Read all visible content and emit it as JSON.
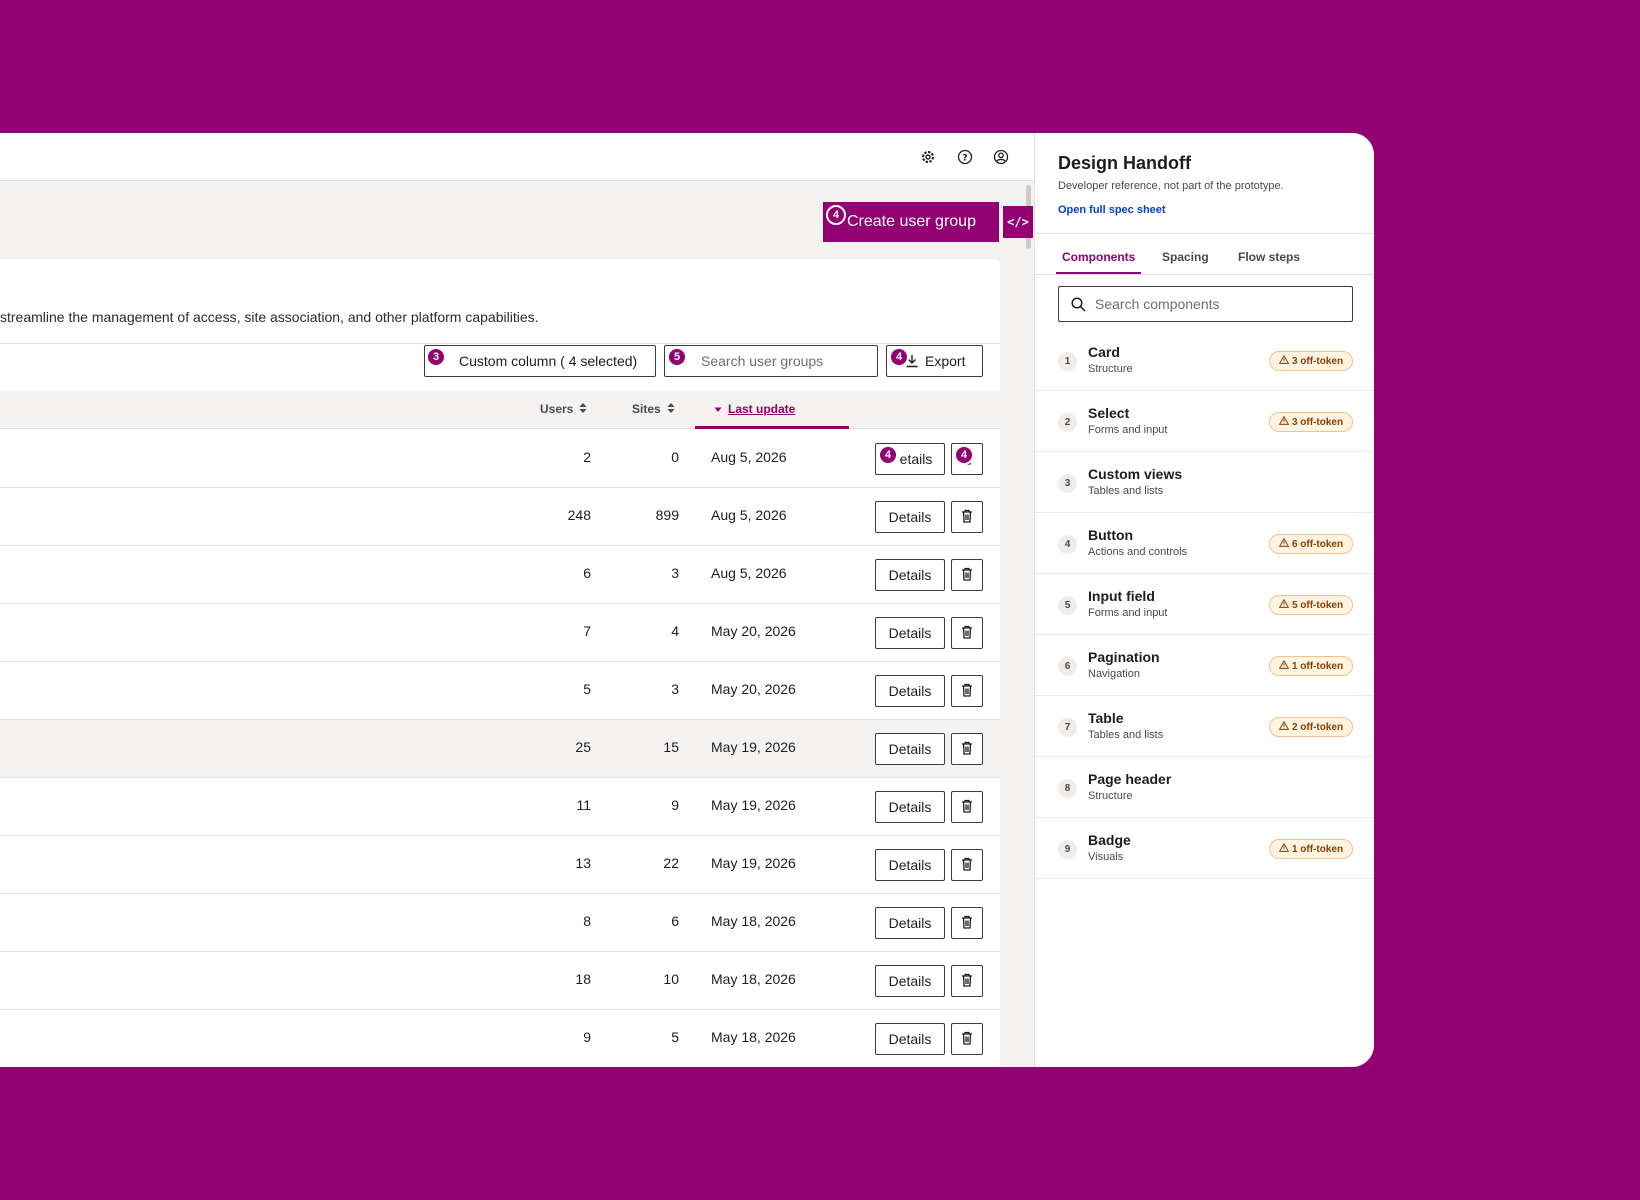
{
  "colors": {
    "brand": "#920071",
    "background": "#920071",
    "link": "#0043ce",
    "badge_bg": "#fff3e2",
    "badge_text": "#8a3f00"
  },
  "topbar": {
    "icons": [
      "gear-icon",
      "help-icon",
      "user-avatar-icon"
    ]
  },
  "page": {
    "create_button_label": "Create user group",
    "create_marker": "4",
    "code_button_label": "</>",
    "description": "streamline the management of access, site association, and other platform capabilities."
  },
  "toolbar": {
    "custom_column_label": "Custom column ( 4  selected)",
    "custom_column_marker": "3",
    "search_placeholder": "Search user groups",
    "search_marker": "5",
    "export_label": "Export",
    "export_marker": "4"
  },
  "table": {
    "columns": {
      "users": "Users",
      "sites": "Sites",
      "last_update": "Last update"
    },
    "details_label": "Details",
    "first_row_markers": [
      "4",
      "4"
    ],
    "rows": [
      {
        "users": "2",
        "sites": "0",
        "date": "Aug 5, 2026",
        "details": "etails"
      },
      {
        "users": "248",
        "sites": "899",
        "date": "Aug 5, 2026",
        "details": "Details"
      },
      {
        "users": "6",
        "sites": "3",
        "date": "Aug 5, 2026",
        "details": "Details"
      },
      {
        "users": "7",
        "sites": "4",
        "date": "May 20, 2026",
        "details": "Details"
      },
      {
        "users": "5",
        "sites": "3",
        "date": "May 20, 2026",
        "details": "Details"
      },
      {
        "users": "25",
        "sites": "15",
        "date": "May 19, 2026",
        "details": "Details"
      },
      {
        "users": "11",
        "sites": "9",
        "date": "May 19, 2026",
        "details": "Details"
      },
      {
        "users": "13",
        "sites": "22",
        "date": "May 19, 2026",
        "details": "Details"
      },
      {
        "users": "8",
        "sites": "6",
        "date": "May 18, 2026",
        "details": "Details"
      },
      {
        "users": "18",
        "sites": "10",
        "date": "May 18, 2026",
        "details": "Details"
      },
      {
        "users": "9",
        "sites": "5",
        "date": "May 18, 2026",
        "details": "Details"
      }
    ]
  },
  "panel": {
    "title": "Design Handoff",
    "subtitle": "Developer reference, not part of the prototype.",
    "link": "Open full spec sheet",
    "tabs": [
      "Components",
      "Spacing",
      "Flow steps"
    ],
    "search_placeholder": "Search components",
    "components": [
      {
        "num": "1",
        "name": "Card",
        "category": "Structure",
        "badge": "3 off-token"
      },
      {
        "num": "2",
        "name": "Select",
        "category": "Forms and input",
        "badge": "3 off-token"
      },
      {
        "num": "3",
        "name": "Custom views",
        "category": "Tables and lists",
        "badge": ""
      },
      {
        "num": "4",
        "name": "Button",
        "category": "Actions and controls",
        "badge": "6 off-token"
      },
      {
        "num": "5",
        "name": "Input field",
        "category": "Forms and input",
        "badge": "5 off-token"
      },
      {
        "num": "6",
        "name": "Pagination",
        "category": "Navigation",
        "badge": "1 off-token"
      },
      {
        "num": "7",
        "name": "Table",
        "category": "Tables and lists",
        "badge": "2 off-token"
      },
      {
        "num": "8",
        "name": "Page header",
        "category": "Structure",
        "badge": ""
      },
      {
        "num": "9",
        "name": "Badge",
        "category": "Visuals",
        "badge": "1 off-token"
      }
    ]
  }
}
